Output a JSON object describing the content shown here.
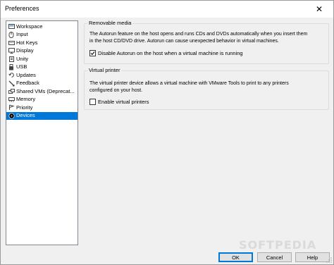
{
  "window": {
    "title": "Preferences",
    "close_glyph": "✕"
  },
  "sidebar": {
    "items": [
      {
        "label": "Workspace",
        "icon": "workspace-icon"
      },
      {
        "label": "Input",
        "icon": "input-icon"
      },
      {
        "label": "Hot Keys",
        "icon": "hotkeys-icon"
      },
      {
        "label": "Display",
        "icon": "display-icon"
      },
      {
        "label": "Unity",
        "icon": "unity-icon"
      },
      {
        "label": "USB",
        "icon": "usb-icon"
      },
      {
        "label": "Updates",
        "icon": "updates-icon"
      },
      {
        "label": "Feedback",
        "icon": "feedback-icon"
      },
      {
        "label": "Shared VMs (Deprecat...",
        "icon": "shared-vms-icon"
      },
      {
        "label": "Memory",
        "icon": "memory-icon"
      },
      {
        "label": "Priority",
        "icon": "priority-icon"
      },
      {
        "label": "Devices",
        "icon": "devices-icon",
        "selected": true
      }
    ]
  },
  "removable_media": {
    "title": "Removable media",
    "description_line1": "The Autorun feature on the host opens and runs CDs and DVDs automatically when you insert them",
    "description_line2": "in the host CD/DVD drive. Autorun can cause unexpected behavior in virtual machines.",
    "checkbox_label": "Disable Autorun on the host when a virtual machine is running",
    "checked": true
  },
  "virtual_printer": {
    "title": "Virtual printer",
    "description_line1": "The virtual printer device allows a virtual machine with VMware Tools to print to any printers",
    "description_line2": "configured on your host.",
    "checkbox_label": "Enable virtual printers",
    "checked": false
  },
  "buttons": {
    "ok": "OK",
    "cancel": "Cancel",
    "help": "Help"
  },
  "watermark": "SOFTPEDIA",
  "colors": {
    "selection": "#0078d7",
    "window_bg": "#f0f0f0"
  }
}
